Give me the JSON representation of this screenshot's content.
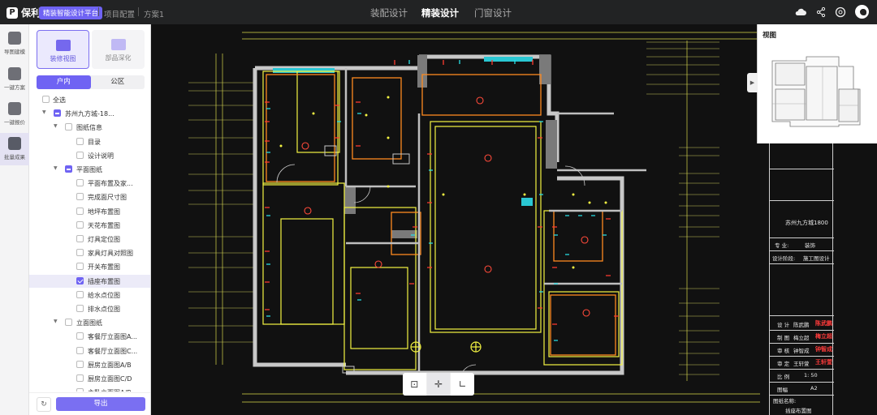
{
  "topbar": {
    "logo": "保利",
    "platform": "精装智能设计平台",
    "breadcrumb": [
      "项目配置",
      "方案1"
    ],
    "tabs": [
      {
        "label": "装配设计",
        "active": false
      },
      {
        "label": "精装设计",
        "active": true
      },
      {
        "label": "门窗设计",
        "active": false
      }
    ],
    "icons": [
      "cloud-icon",
      "share-icon",
      "help-icon",
      "avatar"
    ]
  },
  "rail": {
    "items": [
      {
        "label": "导图建模",
        "icon": "model-icon",
        "active": false
      },
      {
        "label": "一键方案",
        "icon": "scheme-icon",
        "active": false
      },
      {
        "label": "一键报价",
        "icon": "quote-icon",
        "active": false
      },
      {
        "label": "批量成果",
        "icon": "batch-output-icon",
        "active": true
      }
    ]
  },
  "panel": {
    "cards": [
      {
        "label": "装修视图",
        "active": true
      },
      {
        "label": "部品深化",
        "active": false
      }
    ],
    "scope_tabs": [
      {
        "label": "户内",
        "active": true
      },
      {
        "label": "公区",
        "active": false
      }
    ],
    "tree": [
      {
        "label": "全选",
        "level": 0,
        "caret": false,
        "state": "empty"
      },
      {
        "label": "苏州九方城-18...",
        "level": 0,
        "caret": true,
        "state": "partial"
      },
      {
        "label": "图纸信息",
        "level": 1,
        "caret": true,
        "state": "empty"
      },
      {
        "label": "目录",
        "level": 2,
        "caret": false,
        "state": "empty"
      },
      {
        "label": "设计说明",
        "level": 2,
        "caret": false,
        "state": "empty"
      },
      {
        "label": "平面图纸",
        "level": 1,
        "caret": true,
        "state": "partial"
      },
      {
        "label": "平面布置及家...",
        "level": 2,
        "caret": false,
        "state": "empty"
      },
      {
        "label": "完成面尺寸图",
        "level": 2,
        "caret": false,
        "state": "empty"
      },
      {
        "label": "地坪布置图",
        "level": 2,
        "caret": false,
        "state": "empty"
      },
      {
        "label": "天花布置图",
        "level": 2,
        "caret": false,
        "state": "empty"
      },
      {
        "label": "灯具定位图",
        "level": 2,
        "caret": false,
        "state": "empty"
      },
      {
        "label": "家具灯具对照图",
        "level": 2,
        "caret": false,
        "state": "empty"
      },
      {
        "label": "开关布置图",
        "level": 2,
        "caret": false,
        "state": "empty"
      },
      {
        "label": "插座布置图",
        "level": 2,
        "caret": false,
        "state": "checked",
        "selected": true
      },
      {
        "label": "给水点位图",
        "level": 2,
        "caret": false,
        "state": "empty"
      },
      {
        "label": "排水点位图",
        "level": 2,
        "caret": false,
        "state": "empty"
      },
      {
        "label": "立面图纸",
        "level": 1,
        "caret": true,
        "state": "empty"
      },
      {
        "label": "客餐厅立面图A...",
        "level": 2,
        "caret": false,
        "state": "empty"
      },
      {
        "label": "客餐厅立面图C...",
        "level": 2,
        "caret": false,
        "state": "empty"
      },
      {
        "label": "厨房立面图A/B",
        "level": 2,
        "caret": false,
        "state": "empty"
      },
      {
        "label": "厨房立面图C/D",
        "level": 2,
        "caret": false,
        "state": "empty"
      },
      {
        "label": "主卧立面图A/B",
        "level": 2,
        "caret": false,
        "state": "empty"
      }
    ],
    "export_label": "导出",
    "refresh_icon": "refresh-icon"
  },
  "canvas": {
    "toolbar": [
      {
        "icon": "fit-view-icon",
        "glyph": "⊡",
        "active": false
      },
      {
        "icon": "crosshair-icon",
        "glyph": "✛",
        "active": true
      },
      {
        "icon": "measure-icon",
        "glyph": "∟",
        "active": false
      }
    ]
  },
  "viewport": {
    "title": "视图",
    "collapse_icon": "collapse-arrow-icon"
  },
  "titleblock": {
    "project": "苏州九方城1800",
    "major_label": "专  业:",
    "major_value": "装饰",
    "stage_label": "设计阶段:",
    "stage_value": "施工图设计",
    "roles": [
      {
        "role": "设  计",
        "name": "陈武鹏",
        "sign": "陈武鹏"
      },
      {
        "role": "制  图",
        "name": "梅立超",
        "sign": "梅立超"
      },
      {
        "role": "审  核",
        "name": "钟智成",
        "sign": "钟智成"
      },
      {
        "role": "审  定",
        "name": "王轩萱",
        "sign": "王轩萱"
      }
    ],
    "scale_label": "比  例",
    "scale_value": "1: 50",
    "size_label": "图幅",
    "size_value": "A2",
    "drawing_name_label": "图纸名称:",
    "drawing_name": "插座布置图"
  },
  "colors": {
    "accent": "#6f63f3",
    "wall": "#c8c8c8",
    "outline_yellow": "#f4f442",
    "room_orange": "#ff8a1f",
    "socket_red": "#ff3b30",
    "socket_cyan": "#28e0e6"
  }
}
